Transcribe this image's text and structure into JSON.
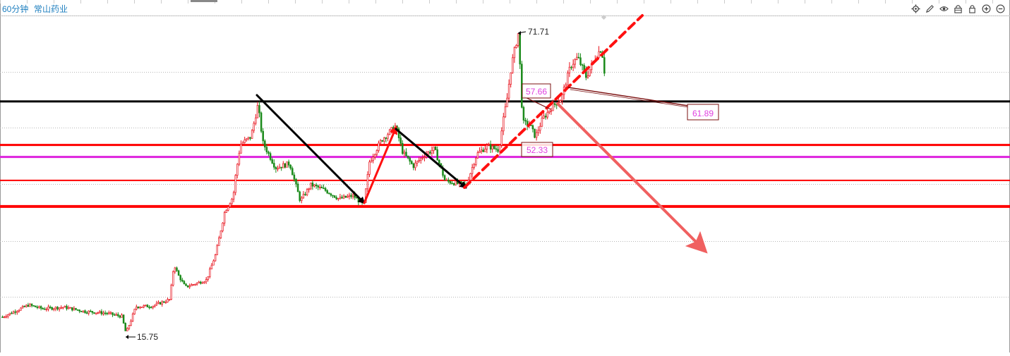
{
  "header": {
    "period": "60分钟",
    "stock_name": "常山药业"
  },
  "toolbar": {
    "icons": [
      "gear-icon",
      "pen-icon",
      "eye-icon",
      "lock-clear-icon",
      "lock-icon",
      "zoom-in-icon",
      "zoom-out-icon"
    ]
  },
  "colors": {
    "up": "#e8141e",
    "down": "#1a8a1a",
    "resistance_line": "#000000",
    "support_line": "#ff0000",
    "mid_line": "#dd22dd",
    "arrow_black": "#000000",
    "arrow_red": "#ff1010",
    "arrow_pink": "#f06060",
    "label_pink": "#e040e0",
    "label_maroon": "#8b1a1a"
  },
  "chart_data": {
    "type": "candlestick",
    "annotations": {
      "high_label": "71.71",
      "low_label": "15.75",
      "label_57": "57.66",
      "label_52": "52.33",
      "label_61": "61.89"
    },
    "key_prices": {
      "high": 71.71,
      "low": 15.75,
      "resistance": 58.9,
      "support_upper": 50.9,
      "mid_level": 48.7,
      "support_mid": 44.4,
      "support_low": 39.6
    },
    "series_path": [
      [
        3,
        19.3
      ],
      [
        40,
        21.5
      ],
      [
        60,
        20.8
      ],
      [
        90,
        21.1
      ],
      [
        120,
        20.3
      ],
      [
        150,
        20.0
      ],
      [
        172,
        19.4
      ],
      [
        178,
        16.3
      ],
      [
        185,
        18.7
      ],
      [
        192,
        21.2
      ],
      [
        215,
        21.3
      ],
      [
        240,
        22.5
      ],
      [
        246,
        29.0
      ],
      [
        252,
        27.0
      ],
      [
        262,
        24.8
      ],
      [
        292,
        26.1
      ],
      [
        305,
        30.8
      ],
      [
        318,
        38.7
      ],
      [
        330,
        41.5
      ],
      [
        333,
        45.0
      ],
      [
        340,
        51.0
      ],
      [
        355,
        52.4
      ],
      [
        365,
        58.3
      ],
      [
        372,
        51.3
      ],
      [
        390,
        46.7
      ],
      [
        410,
        47.5
      ],
      [
        425,
        40.6
      ],
      [
        440,
        43.6
      ],
      [
        460,
        42.6
      ],
      [
        480,
        41.0
      ],
      [
        500,
        41.6
      ],
      [
        515,
        39.8
      ],
      [
        523,
        47.8
      ],
      [
        540,
        51.8
      ],
      [
        560,
        54.4
      ],
      [
        570,
        49.6
      ],
      [
        585,
        47.0
      ],
      [
        600,
        49.0
      ],
      [
        615,
        50.2
      ],
      [
        630,
        44.3
      ],
      [
        660,
        43.5
      ],
      [
        675,
        49.2
      ],
      [
        690,
        50.7
      ],
      [
        706,
        50.0
      ],
      [
        712,
        55.0
      ],
      [
        718,
        59.5
      ],
      [
        724,
        65.5
      ],
      [
        734,
        71.6
      ],
      [
        740,
        55.0
      ],
      [
        750,
        54.6
      ],
      [
        758,
        52.4
      ],
      [
        768,
        55.6
      ],
      [
        780,
        57.7
      ],
      [
        795,
        59.5
      ],
      [
        808,
        65.5
      ],
      [
        818,
        67.0
      ],
      [
        830,
        63.4
      ],
      [
        845,
        67.5
      ],
      [
        852,
        68.7
      ],
      [
        858,
        62.0
      ]
    ]
  }
}
